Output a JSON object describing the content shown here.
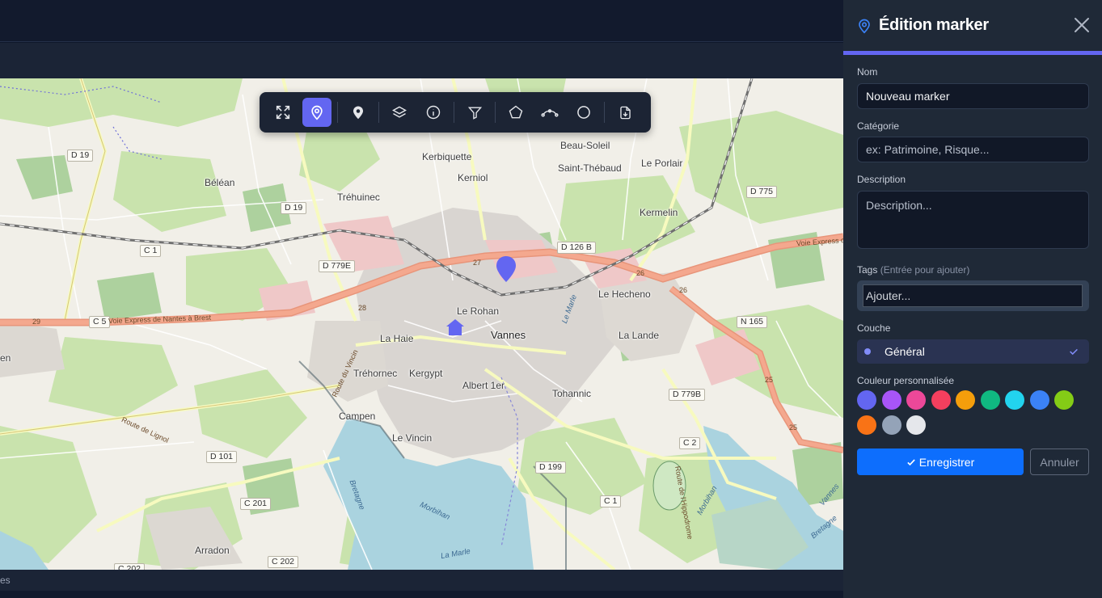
{
  "colors": {
    "accent": "#6366f1",
    "primary_button": "#0d6efd",
    "panel_bg": "#1f2937",
    "marker": "#6366f1"
  },
  "toolbar": {
    "buttons": [
      {
        "icon": "fullscreen-icon"
      },
      {
        "icon": "location-pin-icon",
        "active": true
      },
      {
        "icon": "map-marker-icon"
      },
      {
        "icon": "layers-icon"
      },
      {
        "icon": "info-icon"
      },
      {
        "icon": "filter-icon"
      },
      {
        "icon": "polygon-icon"
      },
      {
        "icon": "polyline-icon"
      },
      {
        "icon": "circle-icon"
      },
      {
        "icon": "export-icon"
      }
    ]
  },
  "map": {
    "places": [
      "Kerbiquette",
      "Beau-Soleil",
      "Saint-Thébaud",
      "Le Porlair",
      "Kerniol",
      "Béléan",
      "Tréhuinec",
      "Kermelin",
      "Le Rohan",
      "Vannes",
      "Le Hecheno",
      "La Haie",
      "La Lande",
      "Tréhornec",
      "Kergypt",
      "Albert 1er",
      "Tohannic",
      "Campen",
      "Le Vincin",
      "Arradon",
      "en"
    ],
    "roads": [
      "D 19",
      "D 19",
      "C 1",
      "D 779E",
      "C 5",
      "D 126 B",
      "D 775",
      "N 165",
      "D 779B",
      "C 2",
      "D 101",
      "D 199",
      "C 1",
      "C 201",
      "C 202",
      "C 202"
    ],
    "route_labels": [
      "Voie Express de Nantes à Brest",
      "Voie Express de",
      "Route du Vincin",
      "Route de Lignol",
      "Route de l'Hippodrome",
      "29",
      "28",
      "27",
      "26",
      "26",
      "25",
      "25"
    ],
    "water_labels": [
      "Le Marle",
      "Morbihan",
      "La Marle",
      "Bretagne",
      "Morbihan",
      "Vannes",
      "Bretagne"
    ]
  },
  "statusbar": {
    "text": "es"
  },
  "panel": {
    "title": "Édition marker",
    "fields": {
      "nom": {
        "label": "Nom",
        "value": "Nouveau marker"
      },
      "categorie": {
        "label": "Catégorie",
        "placeholder": "ex: Patrimoine, Risque..."
      },
      "description": {
        "label": "Description",
        "placeholder": "Description..."
      },
      "tags": {
        "label": "Tags",
        "hint": "(Entrée pour ajouter)",
        "placeholder": "Ajouter..."
      },
      "couche": {
        "label": "Couche",
        "selected": "Général"
      },
      "couleur": {
        "label": "Couleur personnalisée",
        "swatches": [
          "#6366f1",
          "#a855f7",
          "#ec4899",
          "#f43f5e",
          "#f59e0b",
          "#10b981",
          "#22d3ee",
          "#3b82f6",
          "#84cc16",
          "#f97316",
          "#94a3b8",
          "#e5e7eb"
        ]
      }
    },
    "save_label": "Enregistrer",
    "cancel_label": "Annuler"
  }
}
